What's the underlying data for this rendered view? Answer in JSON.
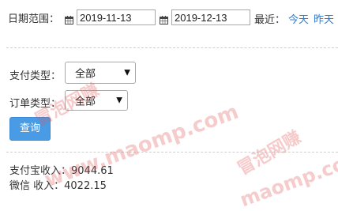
{
  "filters": {
    "date_range_label": "日期范围：",
    "start_date": "2019-11-13",
    "end_date": "2019-12-13",
    "recent_label": "最近：",
    "quick_links": [
      "今天",
      "昨天"
    ]
  },
  "pay_type": {
    "label": "支付类型：",
    "value": "全部"
  },
  "order_type": {
    "label": "订单类型：",
    "value": "全部"
  },
  "query_button": "查询",
  "stats": {
    "alipay": "支付宝收入：9044.61",
    "wechat": "微信 收入：4022.15"
  },
  "watermarks": [
    "冒泡网赚",
    "www.maomp.com",
    "冒泡网赚",
    "maomp.com"
  ],
  "colors": {
    "link": "#2a7bd6",
    "button": "#4a9be6",
    "watermark": "#e25454"
  }
}
